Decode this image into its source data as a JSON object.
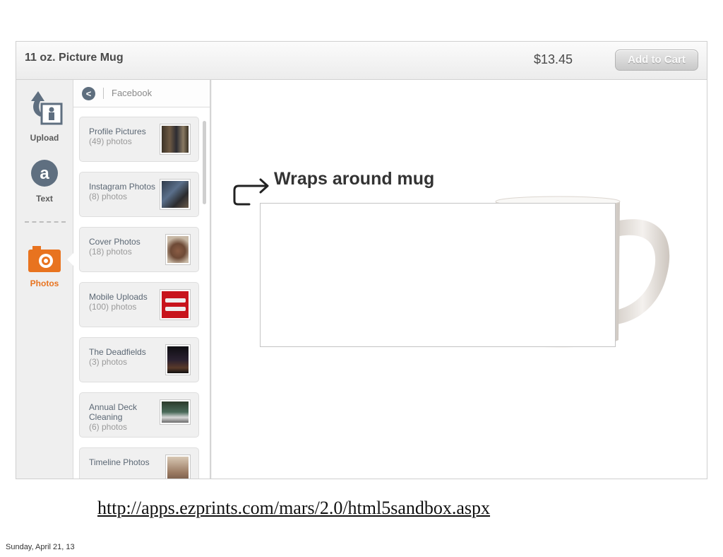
{
  "header": {
    "title": "11 oz. Picture Mug",
    "price": "$13.45",
    "add_to_cart": "Add to Cart"
  },
  "toolbar": {
    "upload": "Upload",
    "text": "Text",
    "photos": "Photos"
  },
  "panel": {
    "back": "<",
    "source": "Facebook",
    "albums": [
      {
        "name": "Profile Pictures",
        "count": "(49) photos"
      },
      {
        "name": "Instagram Photos",
        "count": "(8) photos"
      },
      {
        "name": "Cover Photos",
        "count": "(18) photos"
      },
      {
        "name": "Mobile Uploads",
        "count": "(100) photos"
      },
      {
        "name": "The Deadfields",
        "count": "(3) photos"
      },
      {
        "name": "Annual Deck Cleaning",
        "count": "(6) photos"
      },
      {
        "name": "Timeline Photos",
        "count": ""
      }
    ]
  },
  "canvas": {
    "note": "Wraps around mug"
  },
  "captions": {
    "url": "http://apps.ezprints.com/mars/2.0/html5sandbox.aspx",
    "date": "Sunday, April 21, 13"
  },
  "colors": {
    "accent": "#e8731f",
    "back_button": "#5e6e7e"
  }
}
